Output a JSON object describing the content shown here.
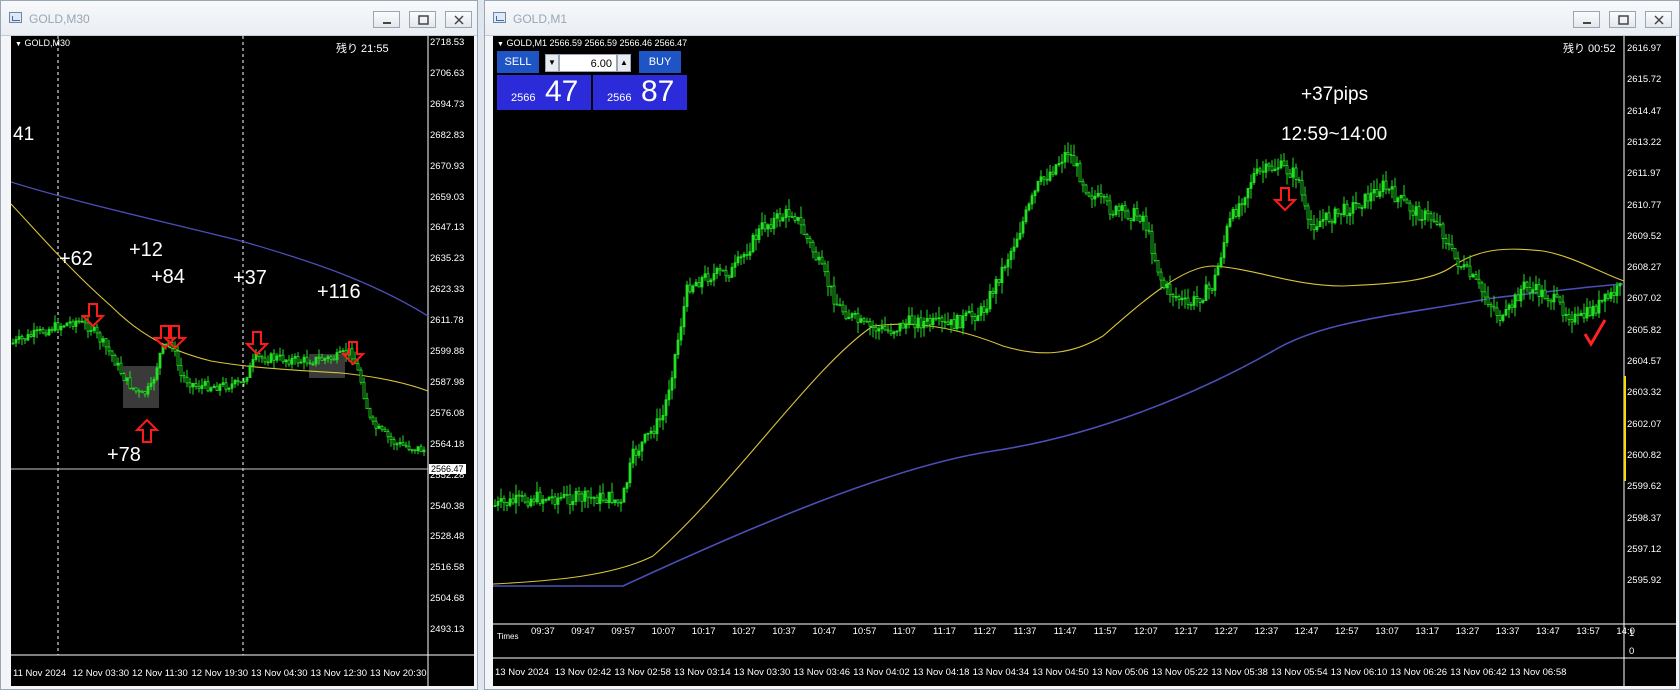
{
  "colors": {
    "candle": "#22e022",
    "ma_fast": "#d8c43a",
    "ma_slow": "#4b4fb8",
    "arrow": "#ff1a1a",
    "check": "#ff2222",
    "range_box": "#3a3a3a"
  },
  "left_window": {
    "title": "GOLD,M30",
    "chart_label": "GOLD,M30",
    "remaining": "残り 21:55",
    "current_price_tag": "2566.47",
    "edge_label": "41",
    "y_labels": [
      "2718.53",
      "2706.63",
      "2694.73",
      "2682.83",
      "2670.93",
      "2659.03",
      "2647.13",
      "2635.23",
      "2623.33",
      "2611.78",
      "2599.88",
      "2587.98",
      "2576.08",
      "2564.18",
      "2552.28",
      "2540.38",
      "2528.48",
      "2516.58",
      "2504.68",
      "2493.13"
    ],
    "x_labels": [
      "11 Nov 2024",
      "12 Nov 03:30",
      "12 Nov 11:30",
      "12 Nov 19:30",
      "13 Nov 04:30",
      "13 Nov 12:30",
      "13 Nov 20:30"
    ],
    "annotations": [
      "+62",
      "+12",
      "+84",
      "+37",
      "+116",
      "+78"
    ],
    "buttons": {
      "minimize_icon": "minimize-icon",
      "maximize_icon": "maximize-icon",
      "close_icon": "close-icon"
    }
  },
  "right_window": {
    "title": "GOLD,M1",
    "chart_label": "GOLD,M1  2566.59 2566.59 2566.46 2566.47",
    "remaining": "残り 00:52",
    "annotation_pips": "+37pips",
    "annotation_time": "12:59~14:00",
    "one_click": {
      "sell_label": "SELL",
      "buy_label": "BUY",
      "lot": "6.00",
      "sell_small": "2566",
      "sell_big": "47",
      "buy_small": "2566",
      "buy_big": "87"
    },
    "y_labels": [
      "2616.97",
      "2615.72",
      "2614.47",
      "2613.22",
      "2611.97",
      "2610.77",
      "2609.52",
      "2608.27",
      "2607.02",
      "2605.82",
      "2604.57",
      "2603.32",
      "2602.07",
      "2600.82",
      "2599.62",
      "2598.37",
      "2597.12",
      "2595.92"
    ],
    "sub_y_labels": [
      "1",
      "0"
    ],
    "sub_window_label": "Times",
    "inner_time_labels": [
      "09:37",
      "09:47",
      "09:57",
      "10:07",
      "10:17",
      "10:27",
      "10:37",
      "10:47",
      "10:57",
      "11:07",
      "11:17",
      "11:27",
      "11:37",
      "11:47",
      "11:57",
      "12:07",
      "12:17",
      "12:27",
      "12:37",
      "12:47",
      "12:57",
      "13:07",
      "13:17",
      "13:27",
      "13:37",
      "13:47",
      "13:57",
      "14:0"
    ],
    "x_labels": [
      "13 Nov 2024",
      "13 Nov 02:42",
      "13 Nov 02:58",
      "13 Nov 03:14",
      "13 Nov 03:30",
      "13 Nov 03:46",
      "13 Nov 04:02",
      "13 Nov 04:18",
      "13 Nov 04:34",
      "13 Nov 04:50",
      "13 Nov 05:06",
      "13 Nov 05:22",
      "13 Nov 05:38",
      "13 Nov 05:54",
      "13 Nov 06:10",
      "13 Nov 06:26",
      "13 Nov 06:42",
      "13 Nov 06:58"
    ]
  }
}
